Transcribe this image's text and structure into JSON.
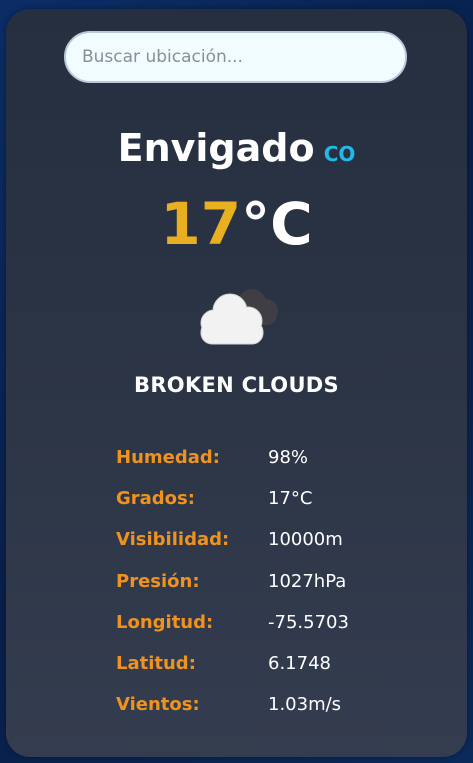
{
  "search": {
    "placeholder": "Buscar ubicación..."
  },
  "location": {
    "city": "Envigado",
    "country": "CO"
  },
  "temperature": {
    "value": "17",
    "unit": "°C"
  },
  "weather": {
    "icon": "broken-clouds-icon",
    "description": "BROKEN CLOUDS"
  },
  "details": [
    {
      "label": "Humedad:",
      "value": "98%"
    },
    {
      "label": "Grados:",
      "value": "17°C"
    },
    {
      "label": "Visibilidad:",
      "value": "10000m"
    },
    {
      "label": "Presión:",
      "value": "1027hPa"
    },
    {
      "label": "Longitud:",
      "value": "-75.5703"
    },
    {
      "label": "Latitud:",
      "value": "6.1748"
    },
    {
      "label": "Vientos:",
      "value": "1.03m/s"
    }
  ],
  "colors": {
    "accent_temperature": "#e8b020",
    "accent_country": "#22b8e8",
    "label_color": "#f0921e"
  }
}
